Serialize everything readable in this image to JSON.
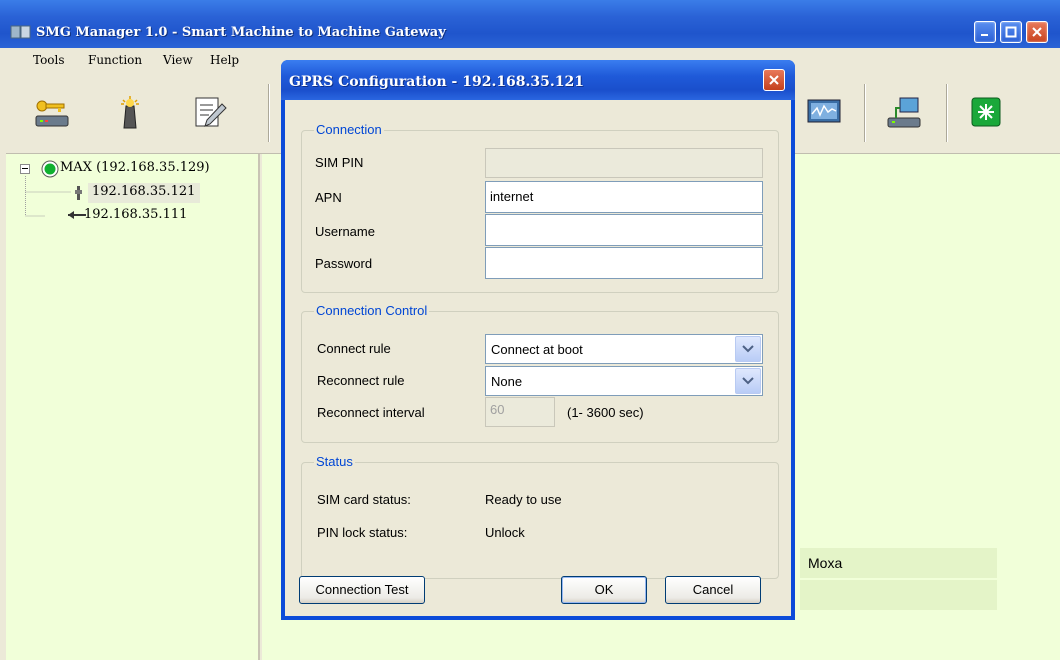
{
  "window": {
    "title": "SMG Manager 1.0 - Smart Machine to Machine Gateway"
  },
  "menu": [
    "Tools",
    "Function",
    "View",
    "Help"
  ],
  "toolbar": {
    "icons": [
      "key-device-icon",
      "light-tower-icon",
      "edit-notepad-icon",
      "monitor-chart-icon",
      "network-device-icon",
      "green-status-icon"
    ]
  },
  "tree": {
    "root": "MAX (192.168.35.129)",
    "children": [
      "192.168.35.121",
      "192.168.35.111"
    ]
  },
  "right_pane": {
    "rows": [
      "Moxa",
      ""
    ]
  },
  "dialog": {
    "title": "GPRS Configuration - 192.168.35.121",
    "connection": {
      "legend": "Connection",
      "sim_pin_label": "SIM PIN",
      "sim_pin_value": "",
      "apn_label": "APN",
      "apn_value": "internet",
      "username_label": "Username",
      "username_value": "",
      "password_label": "Password",
      "password_value": ""
    },
    "control": {
      "legend": "Connection Control",
      "connect_rule_label": "Connect rule",
      "connect_rule_value": "Connect at boot",
      "reconnect_rule_label": "Reconnect rule",
      "reconnect_rule_value": "None",
      "reconnect_interval_label": "Reconnect interval",
      "reconnect_interval_value": "60",
      "reconnect_interval_unit": "(1- 3600 sec)"
    },
    "status": {
      "legend": "Status",
      "sim_card_label": "SIM card status:",
      "sim_card_value": "Ready to use",
      "pin_lock_label": "PIN lock status:",
      "pin_lock_value": "Unlock"
    },
    "buttons": {
      "connection_test": "Connection Test",
      "ok": "OK",
      "cancel": "Cancel"
    }
  }
}
